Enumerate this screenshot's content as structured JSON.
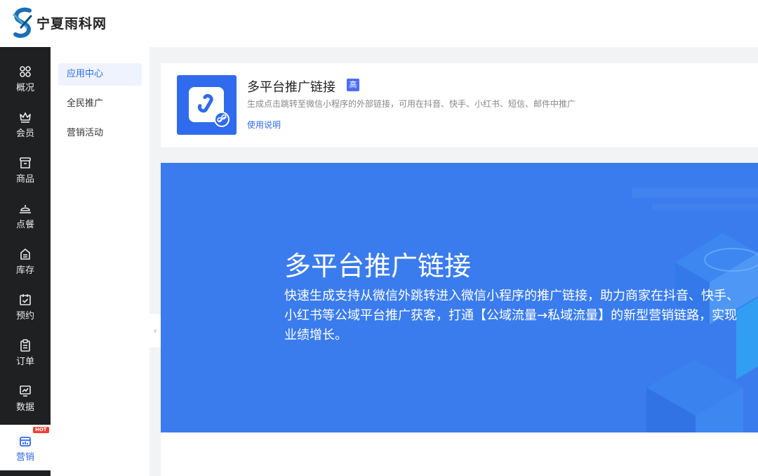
{
  "header": {
    "brand": "宁夏雨科网",
    "logo_icon": "brand-s-logo-icon"
  },
  "sidebar": {
    "items": [
      {
        "label": "概况",
        "icon": "grid-icon"
      },
      {
        "label": "会员",
        "icon": "crown-icon"
      },
      {
        "label": "商品",
        "icon": "shop-icon"
      },
      {
        "label": "点餐",
        "icon": "dish-cover-icon"
      },
      {
        "label": "库存",
        "icon": "inventory-icon"
      },
      {
        "label": "预约",
        "icon": "calendar-check-icon"
      },
      {
        "label": "订单",
        "icon": "clipboard-icon"
      },
      {
        "label": "数据",
        "icon": "chart-screen-icon"
      },
      {
        "label": "营销",
        "icon": "marketing-icon",
        "badge": "HOT",
        "active": true
      }
    ]
  },
  "submenu": {
    "items": [
      {
        "label": "应用中心",
        "active": true
      },
      {
        "label": "全民推广"
      },
      {
        "label": "营销活动"
      }
    ],
    "collapse_glyph": "‹"
  },
  "card": {
    "title": "多平台推广链接",
    "level_badge": "高",
    "description": "生成点击跳转至微信小程序的外部链接，可用在抖音、快手、小红书、短信、邮件中推广",
    "link": "使用说明",
    "icon": "mini-program-link-icon"
  },
  "banner": {
    "title": "多平台推广链接",
    "text": "快速生成支持从微信外跳转进入微信小程序的推广链接，助力商家在抖音、快手、小红书等公域平台推广获客，打通【公域流量→私域流量】的新型营销链路，实现业绩增长。"
  },
  "colors": {
    "accent": "#2f6bec",
    "banner": "#3a7cee",
    "sidebar": "#1f2022",
    "hot": "#ee3d33"
  }
}
